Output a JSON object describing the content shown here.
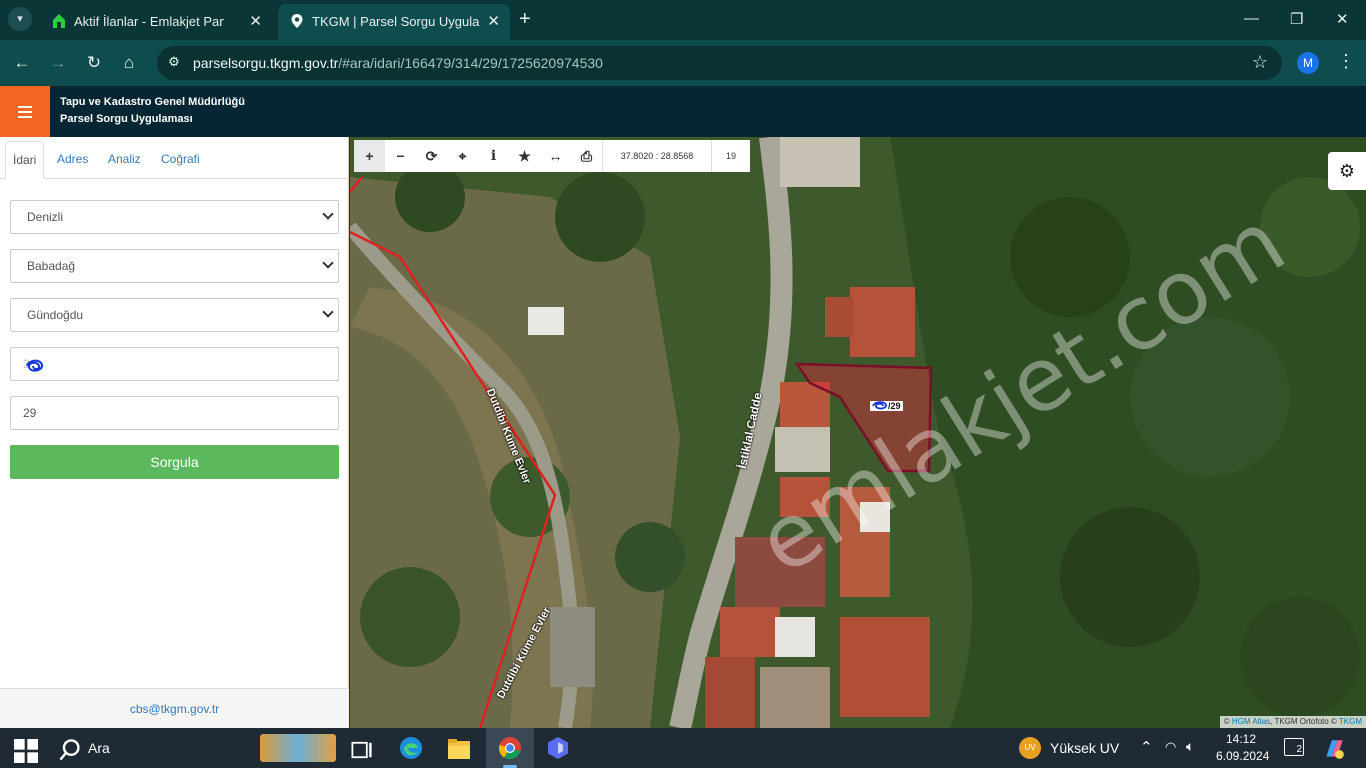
{
  "browser": {
    "tabs": [
      {
        "title": "Aktif İlanlar - Emlakjet Panel",
        "icon": "emlakjet-house-icon"
      },
      {
        "title": "TKGM | Parsel Sorgu Uygulaması",
        "icon": "map-pin-icon",
        "active": true
      }
    ],
    "url_host": "parselsorgu.tkgm.gov.tr",
    "url_path": "/#ara/idari/166479/314/29/1725620974530",
    "profile_initial": "M"
  },
  "app": {
    "org": "Tapu ve Kadastro Genel Müdürlüğü",
    "name": "Parsel Sorgu Uygulaması",
    "accent": "#f26522"
  },
  "panel": {
    "tabs": [
      "İdari",
      "Adres",
      "Analiz",
      "Coğrafi"
    ],
    "active_tab": "İdari",
    "il": "Denizli",
    "ilce": "Babadağ",
    "mahalle": "Gündoğdu",
    "ada": "3",
    "parsel": "29",
    "submit": "Sorgula",
    "footer_email": "cbs@tkgm.gov.tr"
  },
  "map": {
    "coords": "37.8020 : 28.8568",
    "zoom": "19",
    "parcel_label": "/29",
    "road_labels": [
      "Dutdibi Küme Evler",
      "İstiklal Cadde",
      "Dutdibi Küme Evler"
    ],
    "watermark": "emlakjet.com",
    "attribution_prefix": "©",
    "attribution_link": "HGM Atlas",
    "attribution_mid": ", TKGM Ortofoto ©",
    "attribution_end": "TKGM",
    "tools": [
      "zoom-in",
      "zoom-out",
      "refresh",
      "locate",
      "info",
      "favorite",
      "measure",
      "print"
    ]
  },
  "taskbar": {
    "search": "Ara",
    "uv_badge": "UV",
    "uv_text": "Yüksek UV",
    "time": "14:12",
    "date": "6.09.2024",
    "notif_count": "2"
  }
}
